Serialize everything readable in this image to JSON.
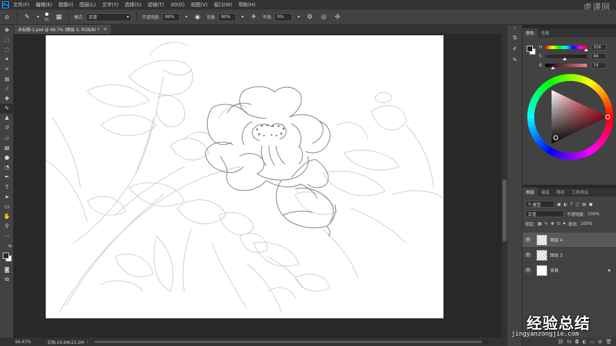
{
  "menubar": {
    "logo": "Ps",
    "items": [
      "文件(F)",
      "编辑(E)",
      "图像(I)",
      "图层(L)",
      "文字(Y)",
      "选择(S)",
      "滤镜(T)",
      "3D(D)",
      "视图(V)",
      "窗口(W)",
      "帮助(H)"
    ],
    "watermark": "虎课网"
  },
  "options": {
    "brush_size": "15",
    "mode_label": "模式:",
    "mode_value": "正常",
    "opacity_label": "不透明度:",
    "opacity_value": "99%",
    "flow_label": "流量:",
    "flow_value": "90%",
    "smoothing_label": "平滑:",
    "smoothing_value": "0%"
  },
  "document": {
    "tab_title": "未标题-1.psd @ 66.7% (图层 4, RGB/8) *",
    "close": "×"
  },
  "status": {
    "zoom": "66.67%",
    "doc_info": "文档:19.6M/23.2M"
  },
  "color_panel": {
    "tabs": [
      "颜色",
      "色板"
    ],
    "h_label": "H",
    "h_value": "356",
    "s_label": "S",
    "s_value": "46",
    "b_label": "B",
    "b_value": "19",
    "hue": 356,
    "saturation": 46,
    "brightness": 19,
    "fg_color": "#301a1b",
    "bg_color": "#ffffff"
  },
  "layers_panel": {
    "tabs": [
      "图层",
      "通道",
      "路径",
      "工具预设"
    ],
    "filter_label": "类型",
    "blend_mode": "正常",
    "opacity_label": "不透明度:",
    "opacity_value": "100%",
    "lock_label": "锁定:",
    "fill_label": "填充:",
    "fill_value": "100%",
    "layers": [
      {
        "name": "图层 4",
        "selected": true
      },
      {
        "name": "图层 3",
        "selected": false
      },
      {
        "name": "背景",
        "selected": false
      }
    ]
  },
  "watermark": {
    "big": "经验总结",
    "small": "jingyanzongjie.com"
  }
}
